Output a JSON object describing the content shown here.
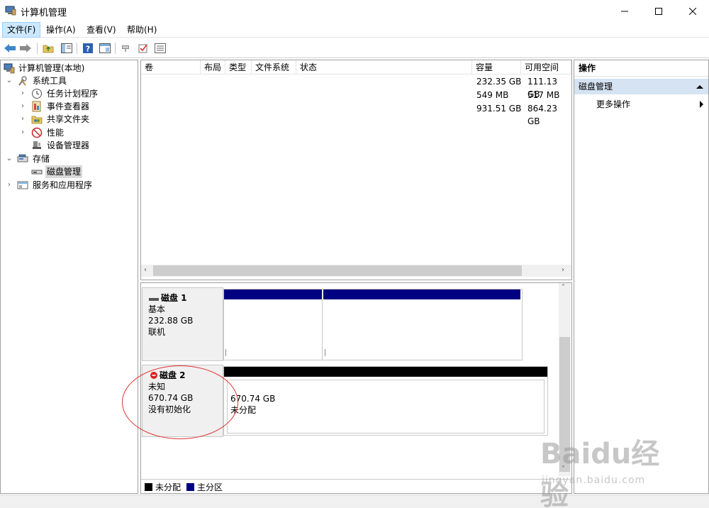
{
  "window": {
    "title": "计算机管理"
  },
  "menu": [
    "文件(F)",
    "操作(A)",
    "查看(V)",
    "帮助(H)"
  ],
  "toolbar_icons": [
    "back-arrow-icon",
    "forward-arrow-icon",
    "up-folder-icon",
    "show-hide-tree-icon",
    "help-icon",
    "properties-icon",
    "connect-icon",
    "check-icon",
    "list-icon"
  ],
  "tree": {
    "root": "计算机管理(本地)",
    "system_tools": "系统工具",
    "task_scheduler": "任务计划程序",
    "event_viewer": "事件查看器",
    "shared_folders": "共享文件夹",
    "performance": "性能",
    "device_manager": "设备管理器",
    "storage": "存储",
    "disk_management": "磁盘管理",
    "services_apps": "服务和应用程序"
  },
  "volumes": {
    "columns": [
      "卷",
      "布局",
      "类型",
      "文件系统",
      "状态",
      "容量",
      "可用空间"
    ],
    "rows": [
      {
        "capacity": "232.35 GB",
        "free": "111.13 GB"
      },
      {
        "capacity": "549 MB",
        "free": "517 MB"
      },
      {
        "capacity": "931.51 GB",
        "free": "864.23 GB"
      }
    ]
  },
  "disks": {
    "disk1": {
      "name": "磁盘 1",
      "type": "基本",
      "size": "232.88 GB",
      "status": "联机"
    },
    "disk2": {
      "name": "磁盘 2",
      "type": "未知",
      "size": "670.74 GB",
      "status": "没有初始化",
      "partition_size": "670.74 GB",
      "partition_status": "未分配"
    }
  },
  "legend": {
    "unallocated": "未分配",
    "primary": "主分区"
  },
  "colors": {
    "unallocated": "#000000",
    "primary": "#000080",
    "selection": "#d5e3f2",
    "annotation": "#e03030"
  },
  "actions": {
    "title": "操作",
    "section": "磁盘管理",
    "more": "更多操作"
  },
  "watermark": {
    "brand": "Baidu经验",
    "url": "jingyan.baidu.com"
  }
}
